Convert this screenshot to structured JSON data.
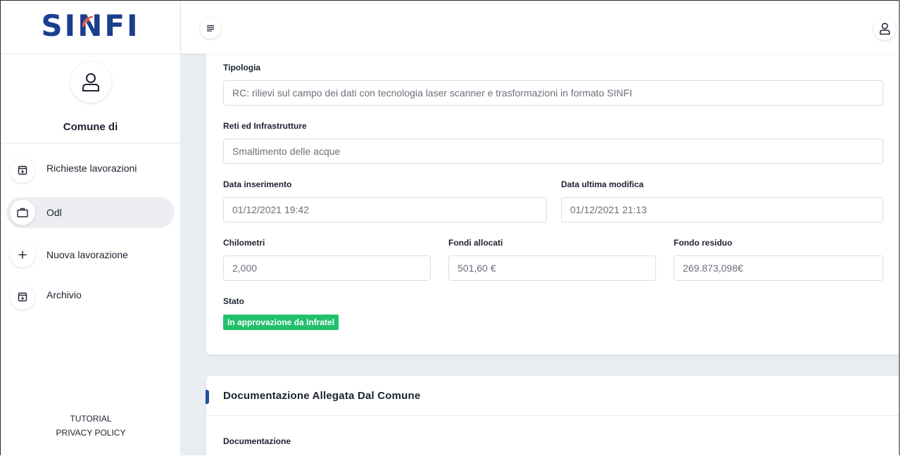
{
  "app": {
    "logo_text": "SINFI",
    "logo_parts": [
      "SI",
      "N",
      "FI"
    ]
  },
  "colors": {
    "brand_blue": "#1b3e8f",
    "logo_wave": "#e8634a",
    "status_green": "#22c06b",
    "accent_blue": "#1f4fa0",
    "main_bg": "#e9ecf0"
  },
  "sidebar": {
    "profile": {
      "icon": "user-icon",
      "name": "Comune di"
    },
    "items": [
      {
        "label": "Richieste lavorazioni",
        "icon": "archive-icon",
        "active": false
      },
      {
        "label": "Odl",
        "icon": "briefcase-icon",
        "active": true
      },
      {
        "label": "Nuova lavorazione",
        "icon": "plus-icon",
        "active": false
      },
      {
        "label": "Archivio",
        "icon": "archive-icon",
        "active": false
      }
    ],
    "footer": {
      "tutorial": "TUTORIAL",
      "privacy": "PRIVACY POLICY"
    }
  },
  "header": {
    "menu_icon": "menu-icon",
    "user_icon": "user-icon"
  },
  "details": {
    "tipologia": {
      "label": "Tipologia",
      "value": "RC: rilievi sul campo dei dati con tecnologia laser scanner e trasformazioni in formato SINFI"
    },
    "reti": {
      "label": "Reti ed Infrastrutture",
      "value": "Smaltimento delle acque"
    },
    "data_inserimento": {
      "label": "Data inserimento",
      "value": "01/12/2021 19:42"
    },
    "data_modifica": {
      "label": "Data ultima modifica",
      "value": "01/12/2021 21:13"
    },
    "chilometri": {
      "label": "Chilometri",
      "value": "2,000"
    },
    "fondi_allocati": {
      "label": "Fondi allocati",
      "value": "501,60 €"
    },
    "fondo_residuo": {
      "label": "Fondo residuo",
      "value": "269.873,098€"
    },
    "stato": {
      "label": "Stato",
      "value": "In approvazione da Infratel"
    }
  },
  "documentation": {
    "title": "Documentazione Allegata Dal Comune",
    "subtitle": "Documentazione"
  }
}
